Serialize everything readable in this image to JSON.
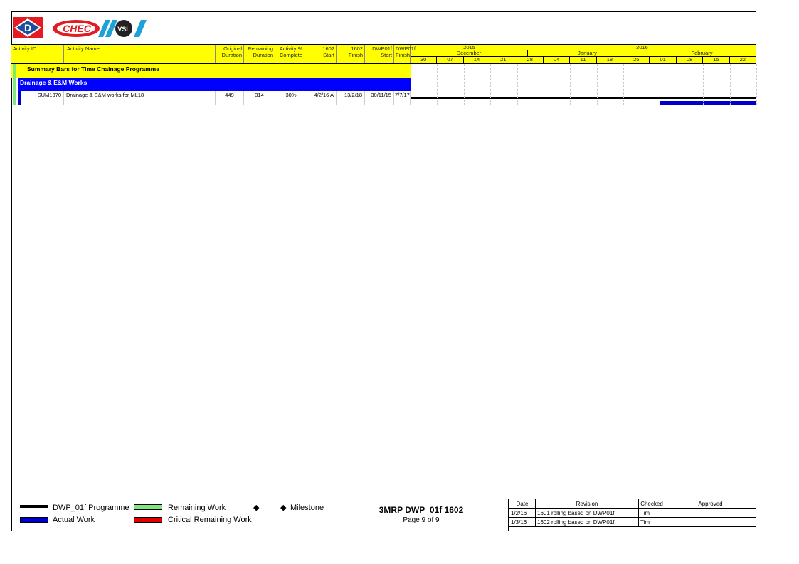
{
  "header": {
    "columns": {
      "activity_id": "Activity ID",
      "activity_name": "Activity Name",
      "original_duration": [
        "Original",
        "Duration"
      ],
      "remaining_duration": [
        "Remaining",
        "Duration"
      ],
      "activity_complete": [
        "Activity %",
        "Complete"
      ],
      "start_1602": [
        "1602",
        "Start"
      ],
      "finish_1602": [
        "1602",
        "Finish"
      ],
      "dwp_start": [
        "DWP01f",
        "Start"
      ],
      "dwp_finish": [
        "DWP01f",
        "Finish"
      ]
    }
  },
  "timescale": {
    "years": [
      "2015",
      "2016"
    ],
    "months": [
      "December",
      "January",
      "February"
    ],
    "weeks": [
      "30",
      "07",
      "14",
      "21",
      "28",
      "04",
      "11",
      "18",
      "25",
      "01",
      "08",
      "15",
      "22"
    ]
  },
  "rows": {
    "summary": "Summary Bars for Time Chainage Programme",
    "group": "Drainage & E&M Works",
    "activity": {
      "id": "SUM1370",
      "name": "Drainage & E&M works for ML18",
      "original_duration": "449",
      "remaining_duration": "314",
      "complete": "30%",
      "start_1602": "4/2/16 A",
      "finish_1602": "13/2/18",
      "dwp_start": "30/11/15",
      "dwp_finish": "7/7/17"
    }
  },
  "legend": {
    "programme": "DWP_01f Programme",
    "remaining": "Remaining Work",
    "milestone": "Milestone",
    "actual": "Actual Work",
    "critical": "Critical Remaining Work"
  },
  "title_block": {
    "title": "3MRP DWP_01f 1602",
    "page": "Page 9 of 9"
  },
  "revisions": {
    "headers": {
      "date": "Date",
      "revision": "Revision",
      "checked": "Checked",
      "approved": "Approved"
    },
    "rows": [
      {
        "date": "1/2/16",
        "revision": "1601 rolling based on DWP01f",
        "checked": "Tim",
        "approved": ""
      },
      {
        "date": "1/3/16",
        "revision": "1602 rolling based on DWP01f",
        "checked": "Tim",
        "approved": ""
      }
    ]
  },
  "logos": {
    "first": "D",
    "second": "CHEC",
    "third": "VSL"
  },
  "colors": {
    "header_yellow": "#ffff00",
    "group_blue": "#0000ff",
    "actual_blue": "#0000cc",
    "remaining_green": "#7ee87e",
    "critical_red": "#e00000"
  }
}
